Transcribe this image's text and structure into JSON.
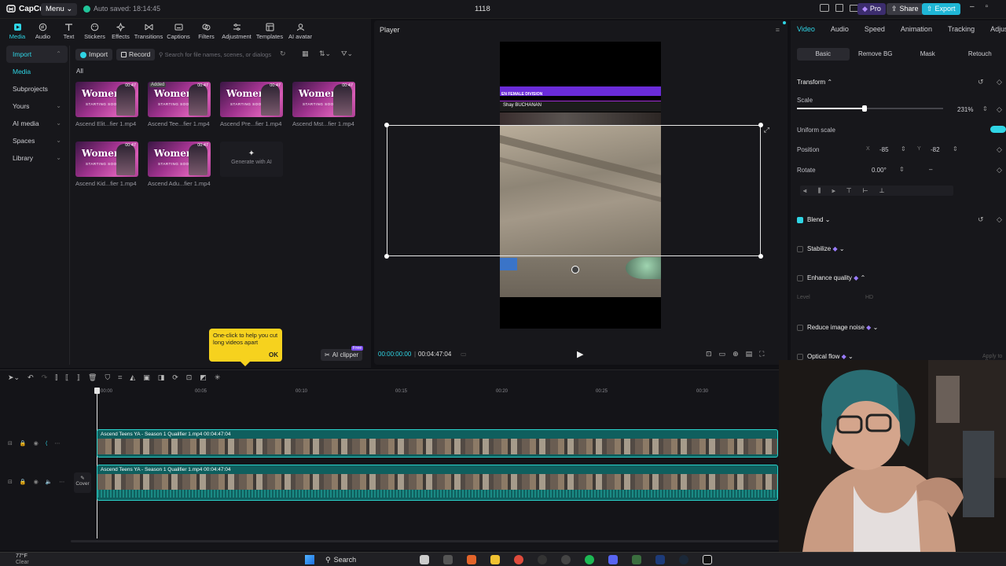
{
  "app": {
    "logo_label": "CapCut",
    "menu_label": "Menu",
    "autosave": "Auto saved: 18:14:45",
    "project_name": "1118",
    "pro_label": "Pro",
    "share_label": "Share",
    "export_label": "Export"
  },
  "toolbar": {
    "items": [
      {
        "label": "Media",
        "icon": "media-icon",
        "active": true
      },
      {
        "label": "Audio",
        "icon": "audio-icon"
      },
      {
        "label": "Text",
        "icon": "text-icon"
      },
      {
        "label": "Stickers",
        "icon": "stickers-icon"
      },
      {
        "label": "Effects",
        "icon": "effects-icon"
      },
      {
        "label": "Transitions",
        "icon": "transitions-icon"
      },
      {
        "label": "Captions",
        "icon": "captions-icon"
      },
      {
        "label": "Filters",
        "icon": "filters-icon"
      },
      {
        "label": "Adjustment",
        "icon": "adjustment-icon"
      },
      {
        "label": "Templates",
        "icon": "templates-icon"
      },
      {
        "label": "AI avatar",
        "icon": "ai-avatar-icon"
      }
    ]
  },
  "sidebar": {
    "items": [
      {
        "label": "Import",
        "chevron": true,
        "selected": true
      },
      {
        "label": "Media",
        "chevron": false,
        "accent": true
      },
      {
        "label": "Subprojects",
        "chevron": false
      },
      {
        "label": "Yours",
        "chevron": true
      },
      {
        "label": "AI media",
        "chevron": true
      },
      {
        "label": "Spaces",
        "chevron": true
      },
      {
        "label": "Library",
        "chevron": true
      }
    ]
  },
  "media": {
    "import_label": "Import",
    "record_label": "Record",
    "search_placeholder": "Search for file names, scenes, or dialogs",
    "filter_all": "All",
    "thumb_text": "Women's",
    "thumb_subtext": "STARTING SOON",
    "added_tag": "Added",
    "clips": [
      {
        "name": "Ascend Elit...fier 1.mp4",
        "duration": "00:47"
      },
      {
        "name": "Ascend Tee...fier 1.mp4",
        "duration": "00:47",
        "added": true
      },
      {
        "name": "Ascend Pre...fier 1.mp4",
        "duration": "00:47"
      },
      {
        "name": "Ascend Mst...fier 1.mp4",
        "duration": "00:47"
      },
      {
        "name": "Ascend Kid...fier 1.mp4",
        "duration": "00:47"
      },
      {
        "name": "Ascend Adu...fier 1.mp4",
        "duration": "00:47"
      }
    ],
    "generate_label": "Generate with AI"
  },
  "tooltip": {
    "text": "One-click to help you cut long videos apart",
    "ok": "OK"
  },
  "ai_clipper": {
    "label": "AI clipper",
    "badge": "Free"
  },
  "player": {
    "title": "Player",
    "current_time": "00:00:00:00",
    "total_time": "00:04:47:04",
    "overlay_banner": "EN FEMALE DIVISION",
    "overlay_name": "Shay BUCHANAN"
  },
  "inspector": {
    "tabs": [
      "Video",
      "Audio",
      "Speed",
      "Animation",
      "Tracking",
      "Adjust"
    ],
    "subtabs": [
      "Basic",
      "Remove BG",
      "Mask",
      "Retouch"
    ],
    "transform_label": "Transform",
    "scale_label": "Scale",
    "scale_value": "231%",
    "scale_fraction": 0.46,
    "uniform_scale_label": "Uniform scale",
    "position_label": "Position",
    "pos_x_label": "X",
    "pos_x": "-85",
    "pos_y_label": "Y",
    "pos_y": "-82",
    "rotate_label": "Rotate",
    "rotate_value": "0.00°",
    "blend_label": "Blend",
    "stabilize_label": "Stabilize",
    "enhance_label": "Enhance quality",
    "level_label": "Level",
    "level_value": "HD",
    "noise_label": "Reduce image noise",
    "optical_label": "Optical flow",
    "apply_label": "Apply to all"
  },
  "timeline": {
    "ruler_ticks": [
      "00:00",
      "00:05",
      "00:10",
      "00:15",
      "00:20",
      "00:25",
      "00:30"
    ],
    "tracks": [
      {
        "name": "Ascend Teens YA - Season 1 Qualifier 1.mp4",
        "duration": "00:04:47:04"
      },
      {
        "name": "Ascend Teens YA - Season 1 Qualifier 1.mp4",
        "duration": "00:04:47:04"
      }
    ],
    "cover_label": "Cover"
  },
  "taskbar": {
    "weather_temp": "77°F",
    "weather_desc": "Clear",
    "search_label": "Search"
  },
  "colors": {
    "accent": "#2fd5e5",
    "export": "#1fb6d6",
    "pro": "#5b3bd1",
    "track": "#0f5f5e"
  }
}
